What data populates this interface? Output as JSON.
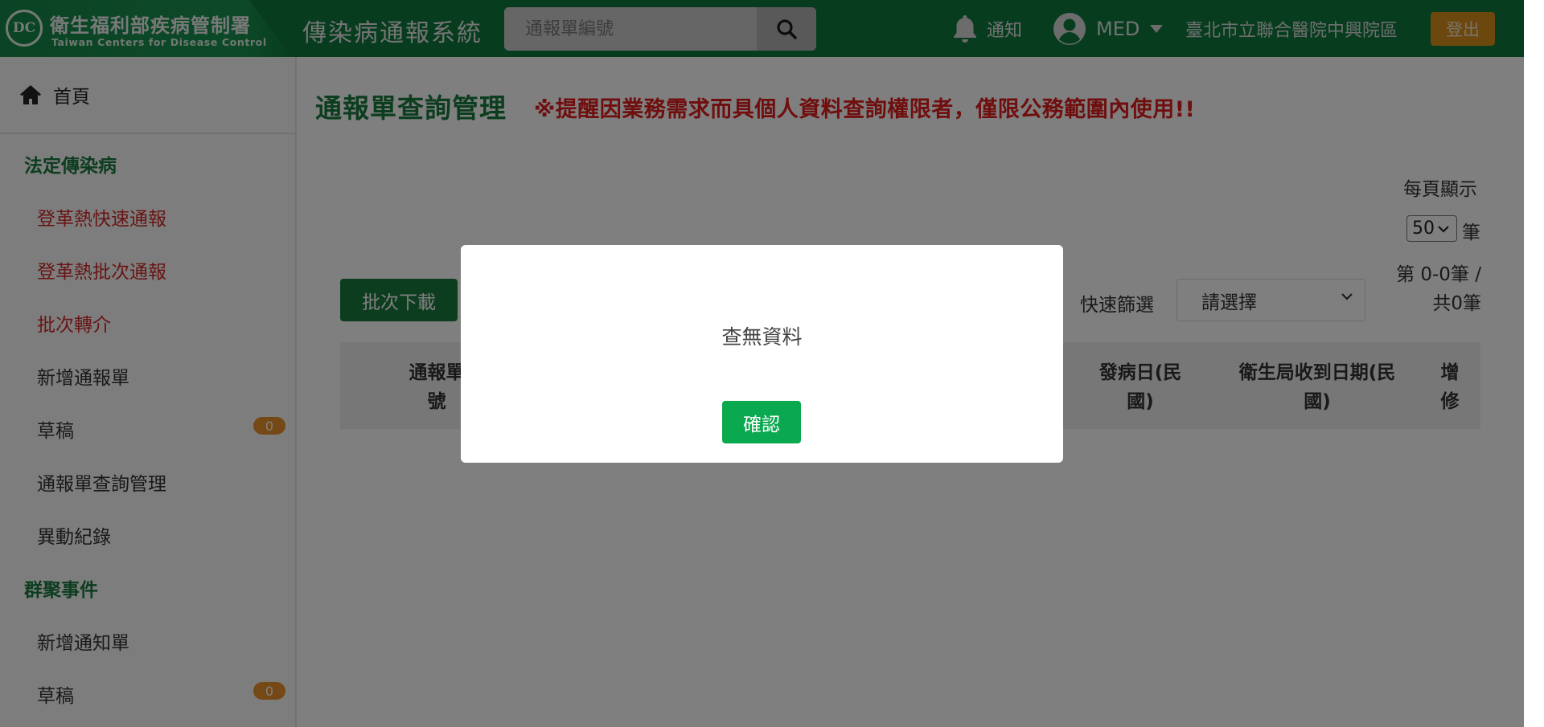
{
  "header": {
    "logo_emblem": "DC",
    "logo_zh": "衛生福利部疾病管制署",
    "logo_en": "Taiwan Centers for Disease Control",
    "system_title": "傳染病通報系統",
    "search_placeholder": "通報單編號",
    "notify_label": "通知",
    "user_name": "MED",
    "hospital": "臺北市立聯合醫院中興院區",
    "logout_label": "登出"
  },
  "sidebar": {
    "home_label": "首頁",
    "section1": "法定傳染病",
    "items1": [
      {
        "label": "登革熱快速通報"
      },
      {
        "label": "登革熱批次通報"
      },
      {
        "label": "批次轉介"
      },
      {
        "label": "新增通報單"
      },
      {
        "label": "草稿",
        "badge": "0"
      },
      {
        "label": "通報單查詢管理"
      },
      {
        "label": "異動紀錄"
      }
    ],
    "section2": "群聚事件",
    "items2": [
      {
        "label": "新增通知單"
      },
      {
        "label": "草稿",
        "badge": "0"
      }
    ]
  },
  "main": {
    "page_title": "通報單查詢管理",
    "warning": "※提醒因業務需求而具個人資料查詢權限者，僅限公務範圍內使用!!",
    "per_page_label": "每頁顯示",
    "per_page_value": "50",
    "per_page_unit": "筆",
    "range_line1": "第 0-0筆 /",
    "range_line2": "共0筆",
    "batch_download": "批次下載",
    "quick_filter_label": "快速篩選",
    "quick_filter_value": "請選擇",
    "table_headers": [
      {
        "l1": "通報單",
        "l2": "號"
      },
      {
        "l1": "發病日(民",
        "l2": "國)"
      },
      {
        "l1": "衛生局收到日期(民",
        "l2": "國)"
      },
      {
        "l1": "增",
        "l2": "修"
      }
    ]
  },
  "modal": {
    "message": "查無資料",
    "confirm_label": "確認"
  },
  "colors": {
    "brand_green": "#1a7a3e",
    "warning_red": "#e01c1c",
    "logout_orange": "#d98f1c",
    "confirm_green": "#0aa84f"
  },
  "icons": [
    "home-icon",
    "search-icon",
    "bell-icon",
    "user-circle-icon",
    "caret-down-icon",
    "chevron-down-icon"
  ]
}
